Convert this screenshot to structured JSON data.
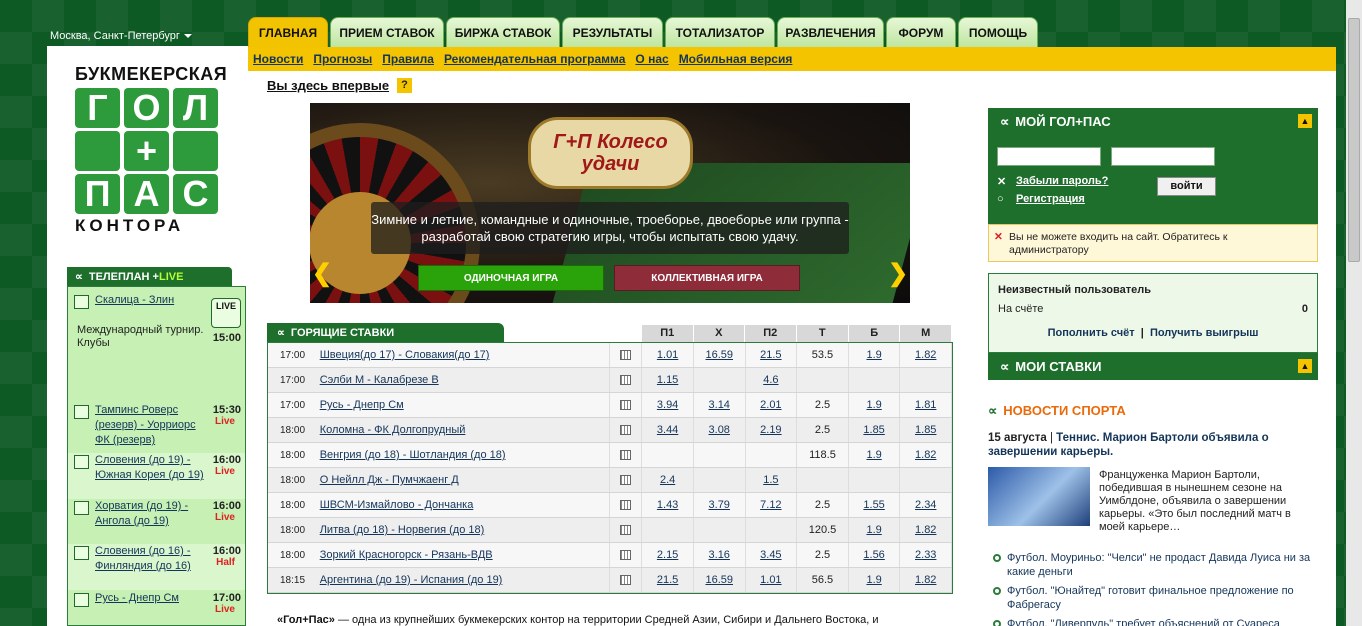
{
  "location": "Москва, Санкт-Петербург",
  "tabs": [
    "ГЛАВНАЯ",
    "ПРИЕМ СТАВОК",
    "БИРЖА СТАВОК",
    "РЕЗУЛЬТАТЫ",
    "ТОТАЛИЗАТОР",
    "РАЗВЛЕЧЕНИЯ",
    "ФОРУМ",
    "ПОМОЩЬ"
  ],
  "subnav": [
    "Новости",
    "Прогнозы",
    "Правила",
    "Рекомендательная программа",
    "О нас",
    "Мобильная версия"
  ],
  "logo": {
    "top": "БУКМЕКЕРСКАЯ",
    "row1": [
      "Г",
      "О",
      "Л"
    ],
    "row2": [
      "+"
    ],
    "row3": [
      "П",
      "А",
      "С"
    ],
    "bottom": "КОНТОРА"
  },
  "teleplan": {
    "title": "ТЕЛЕПЛАН + ",
    "live": "LIVE",
    "items": [
      {
        "name": "Скалица - Злин",
        "time": "15:00",
        "status": "",
        "desc": "Международный турнир. Клубы",
        "badge": "LIVE"
      },
      {
        "name": "Тампинс Роверс (резерв) - Уорриорс ФК (резерв)",
        "time": "15:30",
        "status": "Live"
      },
      {
        "name": "Словения (до 19) - Южная Корея (до 19)",
        "time": "16:00",
        "status": "Live"
      },
      {
        "name": "Хорватия (до 19) - Ангола (до 19)",
        "time": "16:00",
        "status": "Live"
      },
      {
        "name": "Словения (до 16) - Финляндия (до 16)",
        "time": "16:00",
        "status": "Half"
      },
      {
        "name": "Русь - Днепр См",
        "time": "17:00",
        "status": "Live"
      }
    ]
  },
  "first_visit": "Вы здесь впервые",
  "first_visit_q": "?",
  "banner": {
    "sign": "Г+П Колесо удачи",
    "text": "Зимние и летние, командные и одиночные, троеборье, двоеборье или группа - разработай свою стратегию игры, чтобы испытать свою удачу.",
    "btn1": "ОДИНОЧНАЯ ИГРА",
    "btn2": "КОЛЛЕКТИВНАЯ ИГРА",
    "left": "❮",
    "right": "❯"
  },
  "hot_bets": {
    "title": "ГОРЯЩИЕ СТАВКИ",
    "columns": [
      "П1",
      "Х",
      "П2",
      "Т",
      "Б",
      "М"
    ],
    "rows": [
      {
        "time": "17:00",
        "match": "Швеция(до 17) - Словакия(до 17)",
        "p1": "1.01",
        "x": "16.59",
        "p2": "21.5",
        "t": "53.5",
        "b": "1.9",
        "m": "1.82"
      },
      {
        "time": "17:00",
        "match": "Сэлби М - Калабрезе В",
        "p1": "1.15",
        "x": "",
        "p2": "4.6",
        "t": "",
        "b": "",
        "m": ""
      },
      {
        "time": "17:00",
        "match": "Русь - Днепр См",
        "p1": "3.94",
        "x": "3.14",
        "p2": "2.01",
        "t": "2.5",
        "b": "1.9",
        "m": "1.81"
      },
      {
        "time": "18:00",
        "match": "Коломна - ФК Долгопрудный",
        "p1": "3.44",
        "x": "3.08",
        "p2": "2.19",
        "t": "2.5",
        "b": "1.85",
        "m": "1.85"
      },
      {
        "time": "18:00",
        "match": "Венгрия (до 18) - Шотландия (до 18)",
        "p1": "",
        "x": "",
        "p2": "",
        "t": "118.5",
        "b": "1.9",
        "m": "1.82"
      },
      {
        "time": "18:00",
        "match": "О Нейлл Дж - Пумчжаенг Д",
        "p1": "2.4",
        "x": "",
        "p2": "1.5",
        "t": "",
        "b": "",
        "m": ""
      },
      {
        "time": "18:00",
        "match": "ШВСМ-Измайлово - Дончанка",
        "p1": "1.43",
        "x": "3.79",
        "p2": "7.12",
        "t": "2.5",
        "b": "1.55",
        "m": "2.34"
      },
      {
        "time": "18:00",
        "match": "Литва (до 18) - Норвегия (до 18)",
        "p1": "",
        "x": "",
        "p2": "",
        "t": "120.5",
        "b": "1.9",
        "m": "1.82"
      },
      {
        "time": "18:00",
        "match": "Зоркий Красногорск - Рязань-ВДВ",
        "p1": "2.15",
        "x": "3.16",
        "p2": "3.45",
        "t": "2.5",
        "b": "1.56",
        "m": "2.33"
      },
      {
        "time": "18:15",
        "match": "Аргентина (до 19) - Испания (до 19)",
        "p1": "21.5",
        "x": "16.59",
        "p2": "1.01",
        "t": "56.5",
        "b": "1.9",
        "m": "1.82"
      }
    ]
  },
  "about": {
    "brand": "«Гол+Пас»",
    "text": " — одна из крупнейших букмекерских контор на территории Средней Азии, Сибири и Дальнего Востока, и"
  },
  "my": {
    "title": "МОЙ ГОЛ+ПАС",
    "forgot": "Забыли пароль?",
    "register": "Регистрация",
    "login": "войти",
    "error": "Вы не можете входить на сайт. Обратитесь к администратору",
    "user": "Неизвестный пользователь",
    "balance_label": "На счёте",
    "balance": "0",
    "deposit": "Пополнить счёт",
    "withdraw": "Получить выигрыш",
    "stakes": "МОИ СТАВКИ"
  },
  "news": {
    "title": "НОВОСТИ СПОРТА",
    "date": "15 августа",
    "headline": "Теннис. Марион Бартоли объявила о завершении карьеры.",
    "text": "Француженка Марион Бартоли, победившая в нынешнем сезоне на Уимблдоне, объявила о завершении карьеры. «Это был последний матч в моей карьере…",
    "items": [
      "Футбол. Моуриньо: \"Челси\" не продаст Давида Луиса ни за какие деньги",
      "Футбол. \"Юнайтед\" готовит финальное предложение по Фабрегасу",
      "Футбол. \"Ливерпуль\" требует объяснений от Суареса"
    ]
  }
}
